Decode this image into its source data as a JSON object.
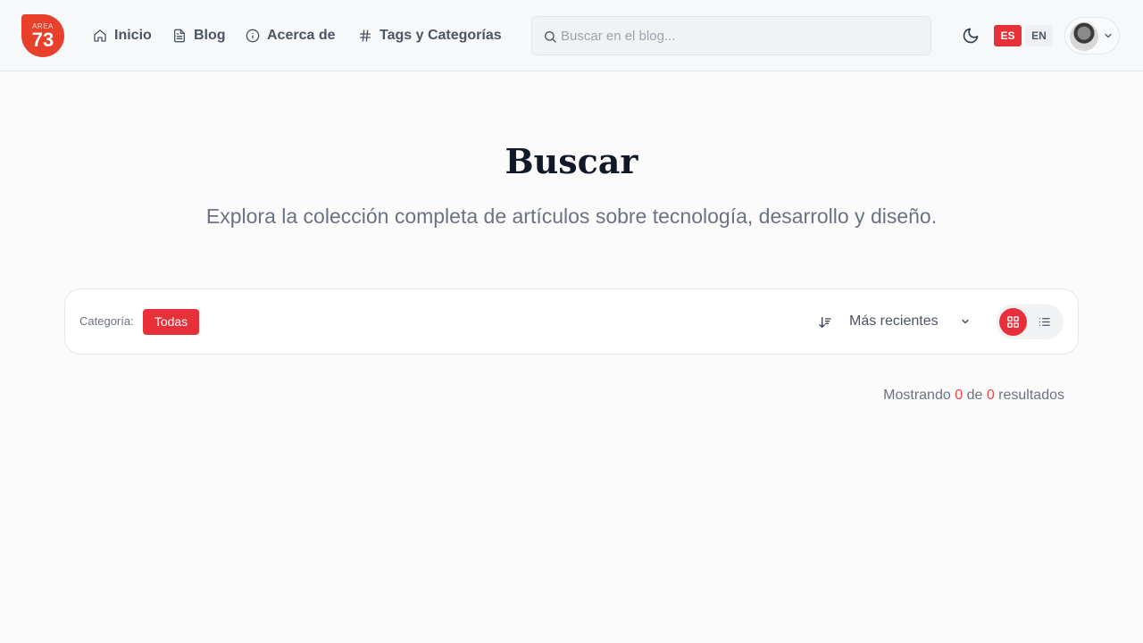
{
  "logo": {
    "top_text": "AREA",
    "number": "73"
  },
  "nav": [
    {
      "label": "Inicio",
      "icon": "home-icon"
    },
    {
      "label": "Blog",
      "icon": "file-text-icon"
    },
    {
      "label": "Acerca de",
      "icon": "info-icon"
    },
    {
      "label": "Tags y Categorías",
      "icon": "hash-icon"
    }
  ],
  "search": {
    "placeholder": "Buscar en el blog...",
    "value": ""
  },
  "languages": {
    "active": "ES",
    "other": "EN"
  },
  "page": {
    "title": "Buscar",
    "subtitle": "Explora la colección completa de artículos sobre tecnología, desarrollo y diseño."
  },
  "filters": {
    "category_label": "Categoría:",
    "category_selected": "Todas",
    "sort_selected": "Más recientes"
  },
  "results": {
    "prefix": "Mostrando",
    "shown": "0",
    "middle": "de",
    "total": "0",
    "suffix": "resultados"
  },
  "colors": {
    "accent": "#e8303a",
    "logo": "#e8402a",
    "background": "#fbfbfc"
  }
}
